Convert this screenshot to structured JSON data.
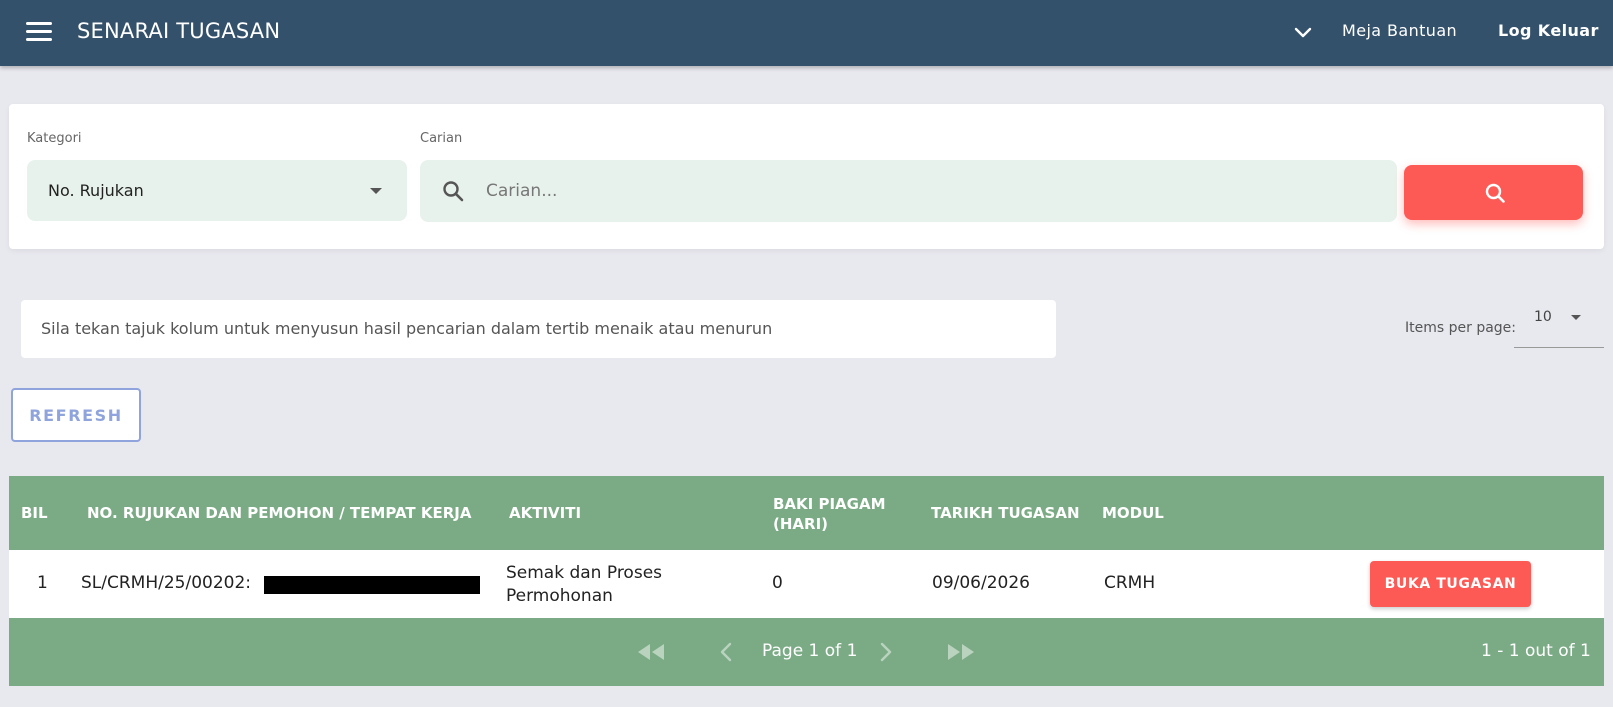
{
  "header": {
    "title": "SENARAI TUGASAN",
    "help_label": "Meja Bantuan",
    "logout_label": "Log Keluar"
  },
  "filter": {
    "category_label": "Kategori",
    "category_value": "No. Rujukan",
    "search_label": "Carian",
    "search_placeholder": "Carian...",
    "search_value": ""
  },
  "info": {
    "message": "Sila tekan tajuk kolum untuk menyusun hasil pencarian dalam tertib menaik atau menurun",
    "items_per_page_label": "Items per page:",
    "items_per_page_value": "10"
  },
  "refresh_label": "REFRESH",
  "table": {
    "columns": [
      "BIL",
      "NO. RUJUKAN DAN PEMOHON / TEMPAT KERJA",
      "AKTIVITI",
      "BAKI PIAGAM",
      "(HARI)",
      "TARIKH TUGASAN",
      "MODUL"
    ],
    "rows": [
      {
        "bil": "1",
        "ref": "SL/CRMH/25/00202:",
        "activity_line1": "Semak dan Proses",
        "activity_line2": "Permohonan",
        "baki": "0",
        "date": "09/06/2026",
        "module": "CRMH",
        "action": "BUKA TUGASAN"
      }
    ]
  },
  "pagination": {
    "page_label": "Page 1 of 1",
    "range_label": "1 - 1 out of 1"
  },
  "colors": {
    "header_bg": "#34516b",
    "accent": "#fe5a55",
    "table_green": "#7bab85",
    "refresh_blue": "#8fa4dc"
  }
}
